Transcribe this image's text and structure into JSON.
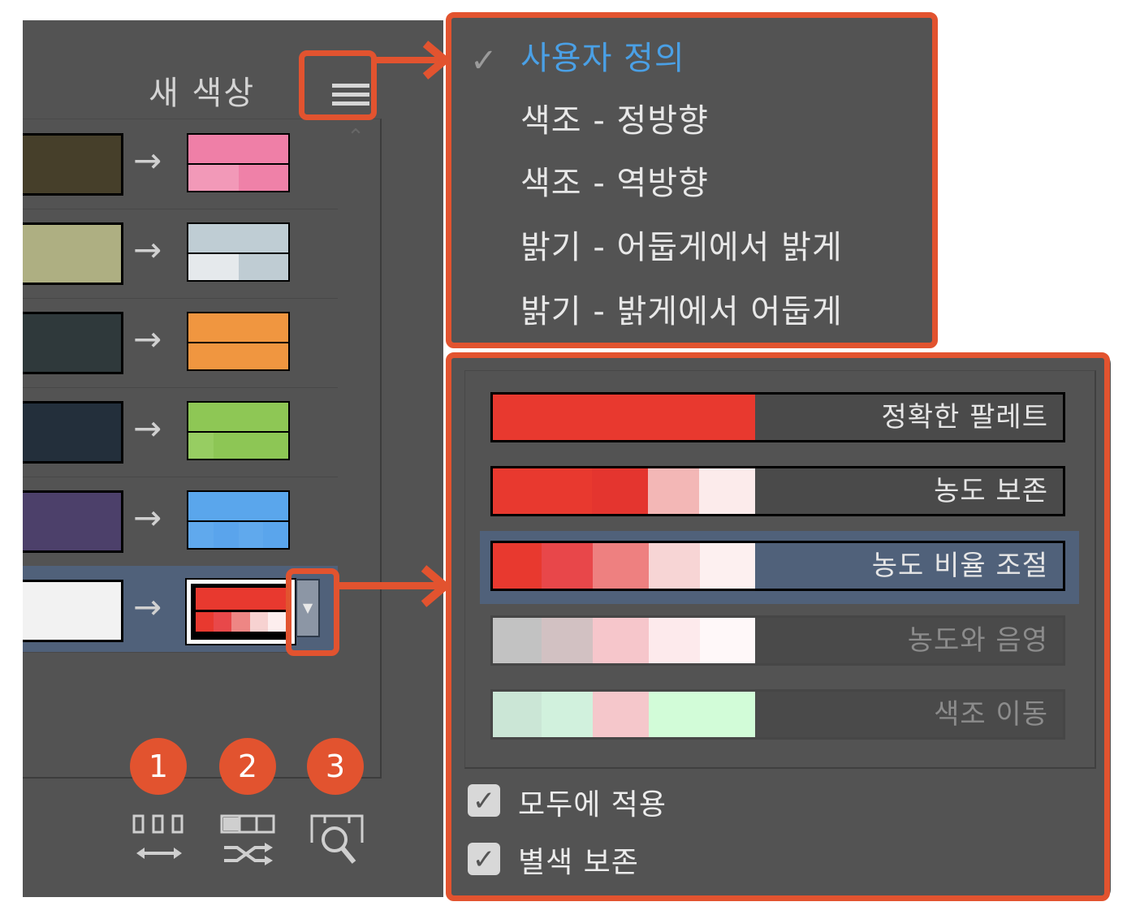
{
  "panel": {
    "title": "새 색상",
    "menu_icon": "hamburger-menu-icon",
    "rows": [
      {
        "current_color": "#463f2a",
        "new_top": "#ef7fa7",
        "new_bottom": [
          "#f299b8",
          "#ef81a8"
        ]
      },
      {
        "current_color": "#aeaf82",
        "new_top": "#bfcdd4",
        "new_bottom": [
          "#e5e9ec",
          "#bfccd3"
        ]
      },
      {
        "current_color": "#2f393b",
        "new_top": "#f09640",
        "new_bottom": [
          "#f09640"
        ]
      },
      {
        "current_color": "#232f3b",
        "new_top": "#8ec755",
        "new_bottom": [
          "#97cd62",
          "#8dc655",
          "#8dc655",
          "#8dc655"
        ]
      },
      {
        "current_color": "#4c406a",
        "new_top": "#5aa6ec",
        "new_bottom": [
          "#60a9ed",
          "#5aa4ec",
          "#60a9ed",
          "#5aa5ec"
        ]
      },
      {
        "current_color": "#f2f2f2",
        "new_top": "#e8392f",
        "new_bottom": [
          "#e8392f",
          "#e8484a",
          "#ee8684",
          "#f7d2d1",
          "#fdeeee"
        ],
        "selected": true
      }
    ],
    "arrow_icon": "right-arrow-icon",
    "dropdown_icon": "dropdown-triangle-icon",
    "tools": [
      {
        "badge": "1",
        "icon": "expand-swatches-icon"
      },
      {
        "badge": "2",
        "icon": "shuffle-colors-icon"
      },
      {
        "badge": "3",
        "icon": "find-color-icon"
      }
    ]
  },
  "mode_menu": {
    "check_icon": "checkmark-icon",
    "items": [
      {
        "label": "사용자 정의",
        "checked": true
      },
      {
        "label": "색조 - 정방향"
      },
      {
        "label": "색조 - 역방향"
      },
      {
        "label": "밝기 - 어둡게에서 밝게"
      },
      {
        "label": "밝기 - 밝게에서 어둡게"
      }
    ]
  },
  "variation_panel": {
    "options": [
      {
        "label": "정확한 팔레트",
        "colors": [
          "#e8392f"
        ]
      },
      {
        "label": "농도 보존",
        "colors": [
          "#e8392f",
          "#e4352f",
          "#f3b7b6",
          "#fcebeb"
        ]
      },
      {
        "label": "농도 비율 조절",
        "colors": [
          "#e8392f",
          "#e8474a",
          "#ee8080",
          "#f7d5d5",
          "#fdf0f0"
        ],
        "selected": true
      },
      {
        "label": "농도와 음영",
        "colors": [
          "#c2c2c2",
          "#d2c1c2",
          "#f6c6cb",
          "#fdeaec",
          "#fff8f9"
        ],
        "disabled": true
      },
      {
        "label": "색조 이동",
        "colors": [
          "#cbe6d6",
          "#d1f1dd",
          "#f5c7cb",
          "#d2fcd8"
        ],
        "disabled": true
      }
    ],
    "checkboxes": [
      {
        "label": "모두에 적용",
        "checked": true
      },
      {
        "label": "별색 보존",
        "checked": true
      }
    ]
  },
  "annotation_color": "#e2532f"
}
